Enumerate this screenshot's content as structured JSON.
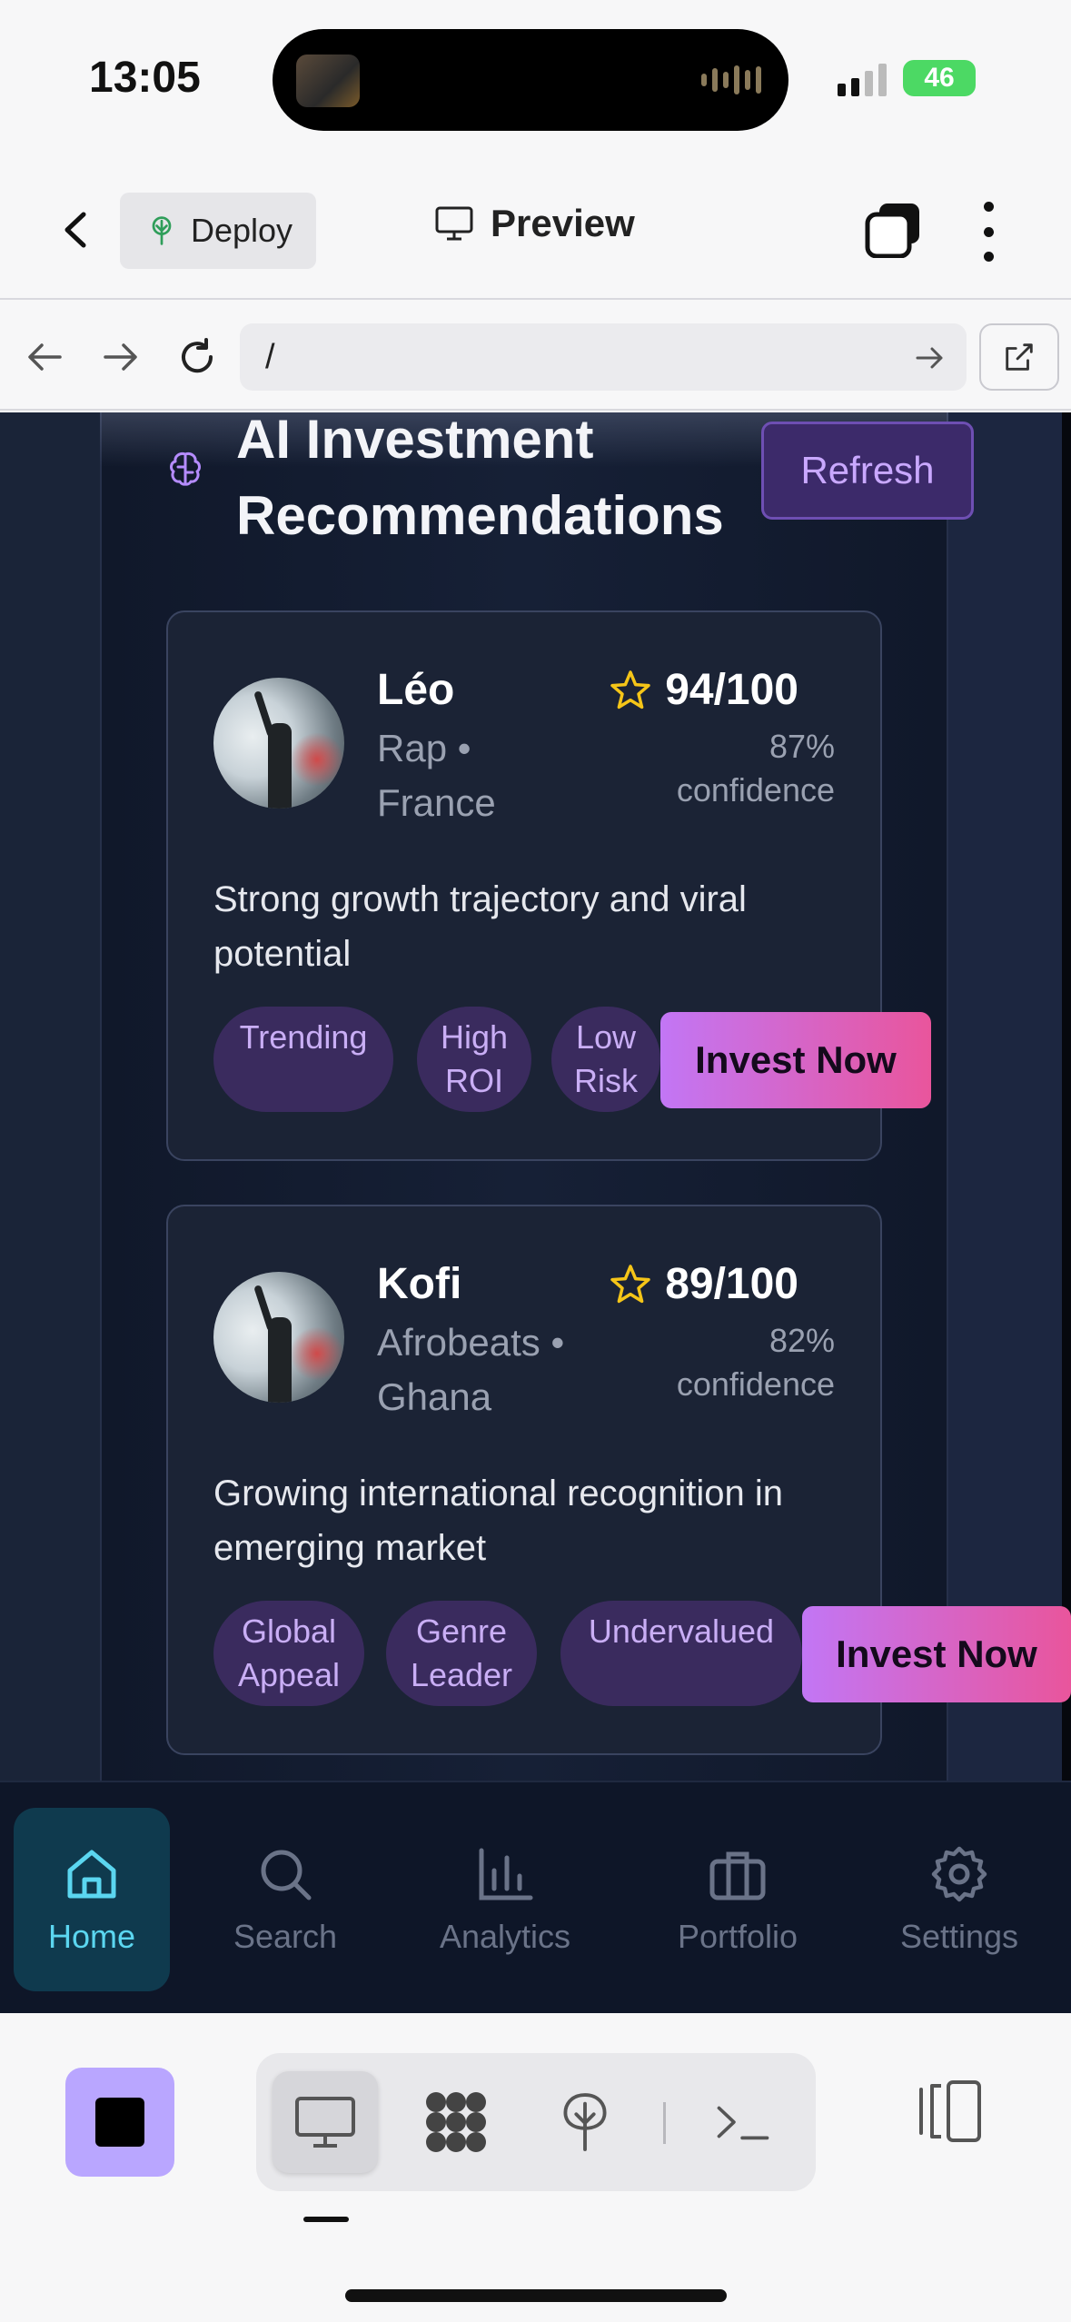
{
  "status_bar": {
    "time": "13:05",
    "battery": "46"
  },
  "app_bar": {
    "deploy_label": "Deploy",
    "preview_label": "Preview"
  },
  "url_bar": {
    "url": "/"
  },
  "section": {
    "title": "AI Investment Recommendations",
    "refresh_label": "Refresh"
  },
  "recommendations": [
    {
      "name": "Léo",
      "meta": "Rap • France",
      "score": "94/100",
      "confidence": "87% confidence",
      "reason": "Strong growth trajectory and viral potential",
      "tags": [
        "Trending",
        "High ROI",
        "Low Risk"
      ],
      "cta": "Invest Now"
    },
    {
      "name": "Kofi",
      "meta": "Afrobeats • Ghana",
      "score": "89/100",
      "confidence": "82% confidence",
      "reason": "Growing international recognition in emerging market",
      "tags": [
        "Global Appeal",
        "Genre Leader",
        "Undervalued"
      ],
      "cta": "Invest Now"
    }
  ],
  "bottom_nav": [
    {
      "label": "Home",
      "icon": "home-icon",
      "active": true
    },
    {
      "label": "Search",
      "icon": "search-icon",
      "active": false
    },
    {
      "label": "Analytics",
      "icon": "bar-chart-icon",
      "active": false
    },
    {
      "label": "Portfolio",
      "icon": "briefcase-icon",
      "active": false
    },
    {
      "label": "Settings",
      "icon": "gear-icon",
      "active": false
    }
  ],
  "colors": {
    "accent_purple": "#c276f5",
    "accent_pink": "#e9559c",
    "active_cyan": "#5bd6f0",
    "star_yellow": "#f5c518",
    "background": "#121a2c"
  }
}
